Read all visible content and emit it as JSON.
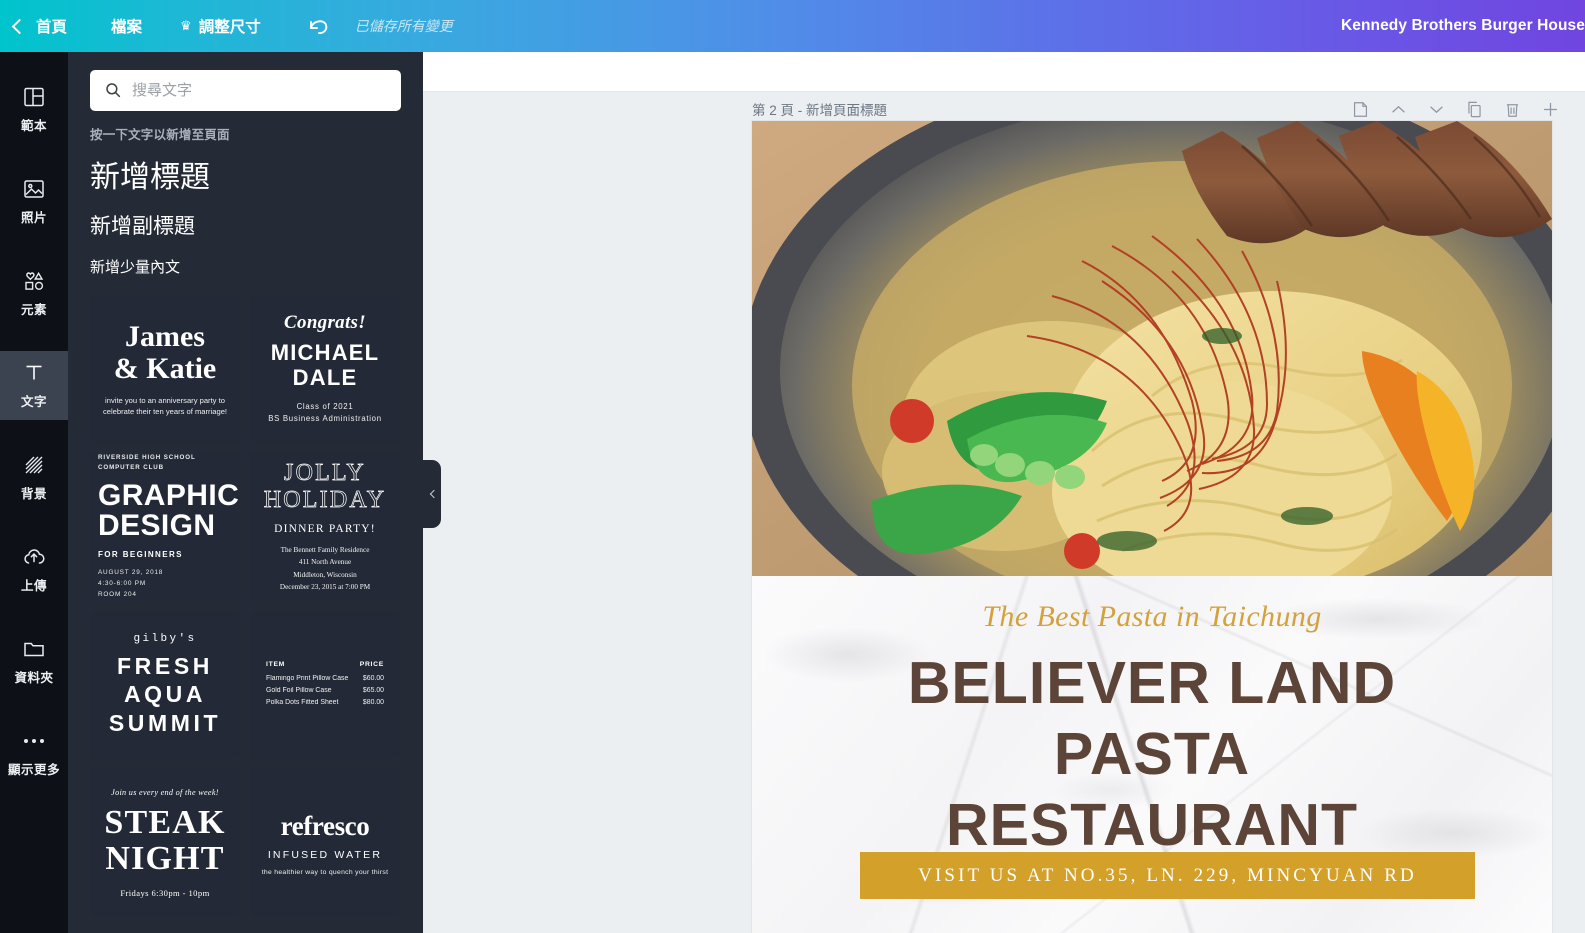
{
  "topbar": {
    "home_label": "首頁",
    "file_label": "檔案",
    "resize_label": "調整尺寸",
    "crown_glyph": "♛",
    "undo_icon": "undo-icon",
    "saved_text": "已儲存所有變更",
    "project_title": "Kennedy Brothers Burger House"
  },
  "rail": {
    "items": [
      {
        "label": "範本",
        "icon": "templates-icon",
        "active": false
      },
      {
        "label": "照片",
        "icon": "photos-icon",
        "active": false
      },
      {
        "label": "元素",
        "icon": "elements-icon",
        "active": false
      },
      {
        "label": "文字",
        "icon": "text-icon",
        "active": true
      },
      {
        "label": "背景",
        "icon": "background-icon",
        "active": false
      },
      {
        "label": "上傳",
        "icon": "upload-icon",
        "active": false
      },
      {
        "label": "資料夾",
        "icon": "folder-icon",
        "active": false
      },
      {
        "label": "顯示更多",
        "icon": "more-icon",
        "active": false
      }
    ]
  },
  "panel": {
    "search_placeholder": "搜尋文字",
    "search_value": "",
    "hint": "按一下文字以新增至頁面",
    "add_heading": "新增標題",
    "add_subheading": "新增副標題",
    "add_body": "新增少量內文",
    "templates": {
      "james": {
        "line1": "James",
        "line2": "& Katie",
        "sub": "invite you to an anniversary party to celebrate their ten years of marriage!"
      },
      "michael": {
        "congrats": "Congrats!",
        "name1": "MICHAEL",
        "name2": "DALE",
        "sub1": "Class of 2021",
        "sub2": "BS Business Administration"
      },
      "graphic": {
        "top1": "RIVERSIDE HIGH SCHOOL",
        "top2": "COMPUTER CLUB",
        "main1": "GRAPHIC",
        "main2": "DESIGN",
        "for": "FOR BEGINNERS",
        "det1": "AUGUST 29, 2018",
        "det2": "4:30-6:00 PM",
        "det3": "ROOM 204"
      },
      "jolly": {
        "line1": "JOLLY",
        "line2": "HOLIDAY",
        "dinner": "DINNER PARTY!",
        "b1": "The Bennett Family Residence",
        "b2": "411 North Avenue",
        "b3": "Middleton, Wisconsin",
        "b4": "December 23, 2015 at 7:00 PM"
      },
      "gilby": {
        "brand": "gilby's",
        "line1": "FRESH AQUA",
        "line2": "SUMMIT"
      },
      "pricelist": {
        "col_item": "ITEM",
        "col_price": "PRICE",
        "rows": [
          {
            "item": "Flamingo Print Pillow Case",
            "price": "$60.00"
          },
          {
            "item": "Gold Foil Pillow Case",
            "price": "$65.00"
          },
          {
            "item": "Polka Dots Fitted Sheet",
            "price": "$80.00"
          }
        ]
      },
      "steak": {
        "joinus": "Join us every end of the week!",
        "line1": "STEAK",
        "line2": "NIGHT",
        "hours": "Fridays 6:30pm - 10pm"
      },
      "refresco": {
        "brand": "refresco",
        "sub": "INFUSED WATER",
        "tag": "the healthier way to quench your thirst"
      }
    },
    "collapse_icon": "chevron-left-icon"
  },
  "editor": {
    "page_title": "第 2 頁 - 新增頁面標題",
    "tools": [
      {
        "name": "edit-page-title-icon"
      },
      {
        "name": "move-page-up-icon"
      },
      {
        "name": "move-page-down-icon"
      },
      {
        "name": "duplicate-page-icon"
      },
      {
        "name": "delete-page-icon"
      },
      {
        "name": "add-page-icon"
      }
    ]
  },
  "design": {
    "tagline": "The Best Pasta in Taichung",
    "title_line1": "BELIEVER LAND",
    "title_line2": "PASTA",
    "title_line3": "RESTAURANT",
    "cta": "VISIT US AT NO.35, LN. 229, MINCYUAN RD",
    "colors": {
      "tagline": "#d4a13a",
      "title": "#5c4438",
      "cta_bg": "#d3a02a",
      "cta_text": "#ffffff"
    }
  }
}
